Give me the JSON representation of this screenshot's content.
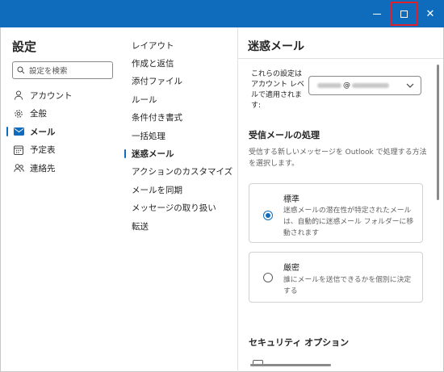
{
  "window": {
    "title_bar_color": "#0f6cbd",
    "highlight_color": "#e0202a",
    "accent": "#0f6cbd"
  },
  "settings": {
    "title": "設定",
    "search_placeholder": "設定を検索",
    "nav": [
      {
        "label": "アカウント",
        "icon": "person-icon"
      },
      {
        "label": "全般",
        "icon": "gear-icon"
      },
      {
        "label": "メール",
        "icon": "mail-icon",
        "active": true
      },
      {
        "label": "予定表",
        "icon": "calendar-icon"
      },
      {
        "label": "連絡先",
        "icon": "people-icon"
      }
    ]
  },
  "mail_nav": {
    "items": [
      "レイアウト",
      "作成と返信",
      "添付ファイル",
      "ルール",
      "条件付き書式",
      "一括処理",
      "迷惑メール",
      "アクションのカスタマイズ",
      "メールを同期",
      "メッセージの取り扱い",
      "転送"
    ],
    "active_index": 6
  },
  "junk": {
    "title": "迷惑メール",
    "apply_label": "これらの設定はアカウント レベルで適用されます:",
    "account_at": "@",
    "incoming_title": "受信メールの処理",
    "incoming_desc": "受信する新しいメッセージを Outlook で処理する方法を選択します。",
    "options": [
      {
        "title": "標準",
        "desc": "迷惑メールの潜在性が特定されたメールは、自動的に迷惑メール フォルダーに移動されます",
        "checked": true
      },
      {
        "title": "厳密",
        "desc": "誰にメールを送信できるかを個別に決定する",
        "checked": false
      }
    ],
    "security_title": "セキュリティ オプション"
  }
}
